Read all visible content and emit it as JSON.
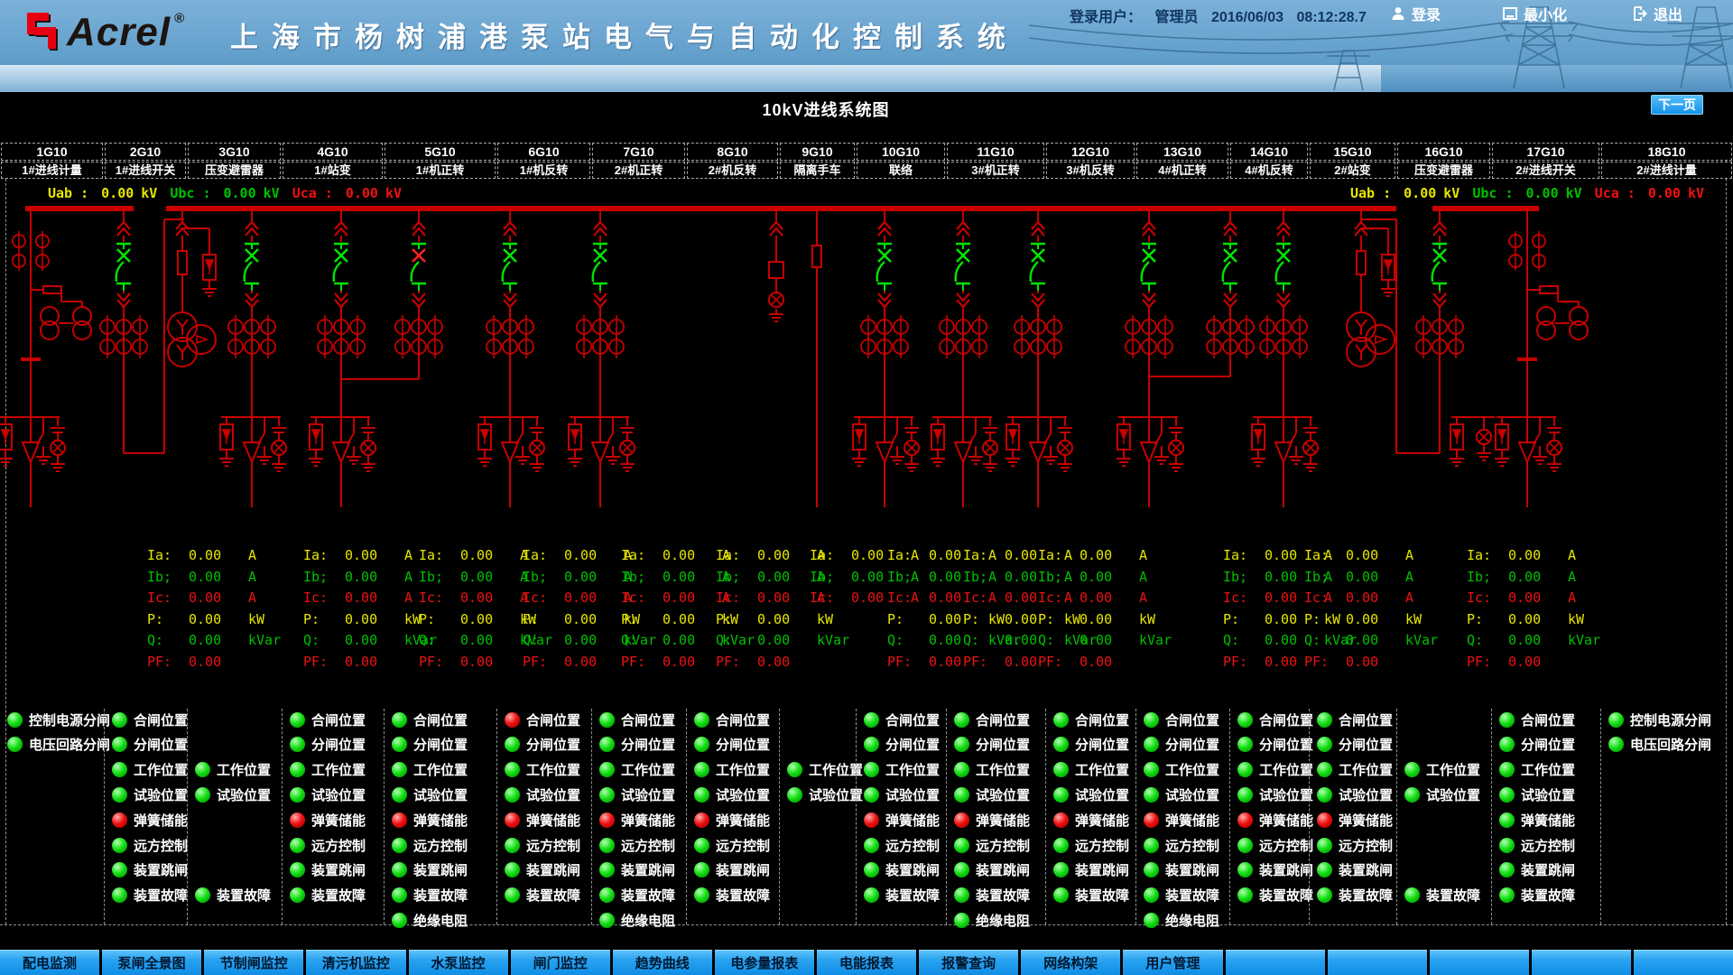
{
  "header": {
    "logo": "Acrel",
    "registered_mark": "®",
    "title": "上海市杨树浦港泵站电气与自动化控制系统"
  },
  "login_bar": {
    "user_label": "登录用户：",
    "user_name": "管理员",
    "date": "2016/06/03",
    "time": "08:12:28.7",
    "login_label": "登录",
    "minimize_label": "最小化",
    "exit_label": "退出"
  },
  "page": {
    "title": "10kV进线系统图",
    "next_page_label": "下一页"
  },
  "feeder_columns": [
    {
      "id": "1G10",
      "label": "1#进线计量"
    },
    {
      "id": "2G10",
      "label": "1#进线开关"
    },
    {
      "id": "3G10",
      "label": "压变避雷器"
    },
    {
      "id": "4G10",
      "label": "1#站变"
    },
    {
      "id": "5G10",
      "label": "1#机正转"
    },
    {
      "id": "6G10",
      "label": "1#机反转"
    },
    {
      "id": "7G10",
      "label": "2#机正转"
    },
    {
      "id": "8G10",
      "label": "2#机反转"
    },
    {
      "id": "9G10",
      "label": "隔离手车"
    },
    {
      "id": "10G10",
      "label": "联络"
    },
    {
      "id": "11G10",
      "label": "3#机正转"
    },
    {
      "id": "12G10",
      "label": "3#机反转"
    },
    {
      "id": "13G10",
      "label": "4#机正转"
    },
    {
      "id": "14G10",
      "label": "4#机反转"
    },
    {
      "id": "15G10",
      "label": "2#站变"
    },
    {
      "id": "16G10",
      "label": "压变避雷器"
    },
    {
      "id": "17G10",
      "label": "2#进线开关"
    },
    {
      "id": "18G10",
      "label": "2#进线计量"
    }
  ],
  "bus_voltages": {
    "left": [
      {
        "label": "Uab :",
        "value": "0.00",
        "unit": "kV",
        "color": "#e6e600"
      },
      {
        "label": "Ubc :",
        "value": "0.00",
        "unit": "kV",
        "color": "#00c000"
      },
      {
        "label": "Uca :",
        "value": "0.00",
        "unit": "kV",
        "color": "#ee1111"
      }
    ],
    "right": [
      {
        "label": "Uab :",
        "value": "0.00",
        "unit": "kV",
        "color": "#e6e600"
      },
      {
        "label": "Ubc :",
        "value": "0.00",
        "unit": "kV",
        "color": "#00c000"
      },
      {
        "label": "Uca :",
        "value": "0.00",
        "unit": "kV",
        "color": "#ee1111"
      }
    ]
  },
  "measurements": {
    "row_defs": [
      {
        "label": "Ia:",
        "value": "0.00",
        "unit": "A",
        "color": "#e6e600"
      },
      {
        "label": "Ib;",
        "value": "0.00",
        "unit": "A",
        "color": "#00c000"
      },
      {
        "label": "Ic:",
        "value": "0.00",
        "unit": "A",
        "color": "#ee1111"
      },
      {
        "label": "P:",
        "value": "0.00",
        "unit": "kW",
        "color": "#e6e600"
      },
      {
        "label": "Q:",
        "value": "0.00",
        "unit": "kVar",
        "color": "#00c000"
      },
      {
        "label": "PF:",
        "value": "0.00",
        "unit": "",
        "color": "#ee1111"
      }
    ],
    "groups": [
      {
        "type": "full"
      },
      {
        "type": "full"
      },
      {
        "type": "full"
      },
      {
        "type": "full"
      },
      {
        "type": "full"
      },
      {
        "type": "full"
      },
      {
        "type": "currents_only"
      },
      {
        "type": "full"
      },
      {
        "type": "full"
      },
      {
        "type": "full"
      },
      {
        "type": "full"
      },
      {
        "type": "full"
      },
      {
        "type": "full"
      }
    ]
  },
  "status_panel": {
    "columns": [
      {
        "leds": [
          {
            "row": 1,
            "label": "控制电源分闸",
            "color": "green"
          },
          {
            "row": 2,
            "label": "电压回路分闸",
            "color": "green"
          }
        ]
      },
      {
        "leds": [
          {
            "row": 1,
            "label": "合闸位置",
            "color": "green"
          },
          {
            "row": 2,
            "label": "分闸位置",
            "color": "green"
          },
          {
            "row": 3,
            "label": "工作位置",
            "color": "green"
          },
          {
            "row": 4,
            "label": "试验位置",
            "color": "green"
          },
          {
            "row": 5,
            "label": "弹簧储能",
            "color": "red"
          },
          {
            "row": 6,
            "label": "远方控制",
            "color": "green"
          },
          {
            "row": 7,
            "label": "装置跳闸",
            "color": "green"
          },
          {
            "row": 8,
            "label": "装置故障",
            "color": "green"
          }
        ]
      },
      {
        "leds": [
          {
            "row": 3,
            "label": "工作位置",
            "color": "green"
          },
          {
            "row": 4,
            "label": "试验位置",
            "color": "green"
          },
          {
            "row": 8,
            "label": "装置故障",
            "color": "green"
          }
        ]
      },
      {
        "leds": [
          {
            "row": 1,
            "label": "合闸位置",
            "color": "green"
          },
          {
            "row": 2,
            "label": "分闸位置",
            "color": "green"
          },
          {
            "row": 3,
            "label": "工作位置",
            "color": "green"
          },
          {
            "row": 4,
            "label": "试验位置",
            "color": "green"
          },
          {
            "row": 5,
            "label": "弹簧储能",
            "color": "red"
          },
          {
            "row": 6,
            "label": "远方控制",
            "color": "green"
          },
          {
            "row": 7,
            "label": "装置跳闸",
            "color": "green"
          },
          {
            "row": 8,
            "label": "装置故障",
            "color": "green"
          }
        ]
      },
      {
        "leds": [
          {
            "row": 1,
            "label": "合闸位置",
            "color": "green"
          },
          {
            "row": 2,
            "label": "分闸位置",
            "color": "green"
          },
          {
            "row": 3,
            "label": "工作位置",
            "color": "green"
          },
          {
            "row": 4,
            "label": "试验位置",
            "color": "green"
          },
          {
            "row": 5,
            "label": "弹簧储能",
            "color": "red"
          },
          {
            "row": 6,
            "label": "远方控制",
            "color": "green"
          },
          {
            "row": 7,
            "label": "装置跳闸",
            "color": "green"
          },
          {
            "row": 8,
            "label": "装置故障",
            "color": "green"
          },
          {
            "row": 9,
            "label": "绝缘电阻",
            "color": "green"
          }
        ]
      },
      {
        "leds": [
          {
            "row": 1,
            "label": "合闸位置",
            "color": "red"
          },
          {
            "row": 2,
            "label": "分闸位置",
            "color": "green"
          },
          {
            "row": 3,
            "label": "工作位置",
            "color": "green"
          },
          {
            "row": 4,
            "label": "试验位置",
            "color": "green"
          },
          {
            "row": 5,
            "label": "弹簧储能",
            "color": "red"
          },
          {
            "row": 6,
            "label": "远方控制",
            "color": "green"
          },
          {
            "row": 7,
            "label": "装置跳闸",
            "color": "green"
          },
          {
            "row": 8,
            "label": "装置故障",
            "color": "green"
          }
        ]
      },
      {
        "leds": [
          {
            "row": 1,
            "label": "合闸位置",
            "color": "green"
          },
          {
            "row": 2,
            "label": "分闸位置",
            "color": "green"
          },
          {
            "row": 3,
            "label": "工作位置",
            "color": "green"
          },
          {
            "row": 4,
            "label": "试验位置",
            "color": "green"
          },
          {
            "row": 5,
            "label": "弹簧储能",
            "color": "red"
          },
          {
            "row": 6,
            "label": "远方控制",
            "color": "green"
          },
          {
            "row": 7,
            "label": "装置跳闸",
            "color": "green"
          },
          {
            "row": 8,
            "label": "装置故障",
            "color": "green"
          },
          {
            "row": 9,
            "label": "绝缘电阻",
            "color": "green"
          }
        ]
      },
      {
        "leds": [
          {
            "row": 1,
            "label": "合闸位置",
            "color": "green"
          },
          {
            "row": 2,
            "label": "分闸位置",
            "color": "green"
          },
          {
            "row": 3,
            "label": "工作位置",
            "color": "green"
          },
          {
            "row": 4,
            "label": "试验位置",
            "color": "green"
          },
          {
            "row": 5,
            "label": "弹簧储能",
            "color": "red"
          },
          {
            "row": 6,
            "label": "远方控制",
            "color": "green"
          },
          {
            "row": 7,
            "label": "装置跳闸",
            "color": "green"
          },
          {
            "row": 8,
            "label": "装置故障",
            "color": "green"
          }
        ]
      },
      {
        "leds": [
          {
            "row": 3,
            "label": "工作位置",
            "color": "green"
          },
          {
            "row": 4,
            "label": "试验位置",
            "color": "green"
          }
        ]
      },
      {
        "leds": [
          {
            "row": 1,
            "label": "合闸位置",
            "color": "green"
          },
          {
            "row": 2,
            "label": "分闸位置",
            "color": "green"
          },
          {
            "row": 3,
            "label": "工作位置",
            "color": "green"
          },
          {
            "row": 4,
            "label": "试验位置",
            "color": "green"
          },
          {
            "row": 5,
            "label": "弹簧储能",
            "color": "red"
          },
          {
            "row": 6,
            "label": "远方控制",
            "color": "green"
          },
          {
            "row": 7,
            "label": "装置跳闸",
            "color": "green"
          },
          {
            "row": 8,
            "label": "装置故障",
            "color": "green"
          }
        ]
      },
      {
        "leds": [
          {
            "row": 1,
            "label": "合闸位置",
            "color": "green"
          },
          {
            "row": 2,
            "label": "分闸位置",
            "color": "green"
          },
          {
            "row": 3,
            "label": "工作位置",
            "color": "green"
          },
          {
            "row": 4,
            "label": "试验位置",
            "color": "green"
          },
          {
            "row": 5,
            "label": "弹簧储能",
            "color": "red"
          },
          {
            "row": 6,
            "label": "远方控制",
            "color": "green"
          },
          {
            "row": 7,
            "label": "装置跳闸",
            "color": "green"
          },
          {
            "row": 8,
            "label": "装置故障",
            "color": "green"
          },
          {
            "row": 9,
            "label": "绝缘电阻",
            "color": "green"
          }
        ]
      },
      {
        "leds": [
          {
            "row": 1,
            "label": "合闸位置",
            "color": "green"
          },
          {
            "row": 2,
            "label": "分闸位置",
            "color": "green"
          },
          {
            "row": 3,
            "label": "工作位置",
            "color": "green"
          },
          {
            "row": 4,
            "label": "试验位置",
            "color": "green"
          },
          {
            "row": 5,
            "label": "弹簧储能",
            "color": "red"
          },
          {
            "row": 6,
            "label": "远方控制",
            "color": "green"
          },
          {
            "row": 7,
            "label": "装置跳闸",
            "color": "green"
          },
          {
            "row": 8,
            "label": "装置故障",
            "color": "green"
          }
        ]
      },
      {
        "leds": [
          {
            "row": 1,
            "label": "合闸位置",
            "color": "green"
          },
          {
            "row": 2,
            "label": "分闸位置",
            "color": "green"
          },
          {
            "row": 3,
            "label": "工作位置",
            "color": "green"
          },
          {
            "row": 4,
            "label": "试验位置",
            "color": "green"
          },
          {
            "row": 5,
            "label": "弹簧储能",
            "color": "red"
          },
          {
            "row": 6,
            "label": "远方控制",
            "color": "green"
          },
          {
            "row": 7,
            "label": "装置跳闸",
            "color": "green"
          },
          {
            "row": 8,
            "label": "装置故障",
            "color": "green"
          },
          {
            "row": 9,
            "label": "绝缘电阻",
            "color": "green"
          }
        ]
      },
      {
        "leds": [
          {
            "row": 1,
            "label": "合闸位置",
            "color": "green"
          },
          {
            "row": 2,
            "label": "分闸位置",
            "color": "green"
          },
          {
            "row": 3,
            "label": "工作位置",
            "color": "green"
          },
          {
            "row": 4,
            "label": "试验位置",
            "color": "green"
          },
          {
            "row": 5,
            "label": "弹簧储能",
            "color": "red"
          },
          {
            "row": 6,
            "label": "远方控制",
            "color": "green"
          },
          {
            "row": 7,
            "label": "装置跳闸",
            "color": "green"
          },
          {
            "row": 8,
            "label": "装置故障",
            "color": "green"
          }
        ]
      },
      {
        "leds": [
          {
            "row": 1,
            "label": "合闸位置",
            "color": "green"
          },
          {
            "row": 2,
            "label": "分闸位置",
            "color": "green"
          },
          {
            "row": 3,
            "label": "工作位置",
            "color": "green"
          },
          {
            "row": 4,
            "label": "试验位置",
            "color": "green"
          },
          {
            "row": 5,
            "label": "弹簧储能",
            "color": "red"
          },
          {
            "row": 6,
            "label": "远方控制",
            "color": "green"
          },
          {
            "row": 7,
            "label": "装置跳闸",
            "color": "green"
          },
          {
            "row": 8,
            "label": "装置故障",
            "color": "green"
          }
        ]
      },
      {
        "leds": [
          {
            "row": 3,
            "label": "工作位置",
            "color": "green"
          },
          {
            "row": 4,
            "label": "试验位置",
            "color": "green"
          },
          {
            "row": 8,
            "label": "装置故障",
            "color": "green"
          }
        ]
      },
      {
        "leds": [
          {
            "row": 1,
            "label": "合闸位置",
            "color": "green"
          },
          {
            "row": 2,
            "label": "分闸位置",
            "color": "green"
          },
          {
            "row": 3,
            "label": "工作位置",
            "color": "green"
          },
          {
            "row": 4,
            "label": "试验位置",
            "color": "green"
          },
          {
            "row": 5,
            "label": "弹簧储能",
            "color": "green"
          },
          {
            "row": 6,
            "label": "远方控制",
            "color": "green"
          },
          {
            "row": 7,
            "label": "装置跳闸",
            "color": "green"
          },
          {
            "row": 8,
            "label": "装置故障",
            "color": "green"
          }
        ]
      },
      {
        "leds": [
          {
            "row": 1,
            "label": "控制电源分闸",
            "color": "green"
          },
          {
            "row": 2,
            "label": "电压回路分闸",
            "color": "green"
          }
        ]
      }
    ]
  },
  "nav": {
    "tabs": [
      "配电监测",
      "泵闸全景图",
      "节制闸监控",
      "清污机监控",
      "水泵监控",
      "闸门监控",
      "趋势曲线",
      "电参量报表",
      "电能报表",
      "报警查询",
      "网络构架",
      "用户管理"
    ],
    "empty_slots": 5
  },
  "colors": {
    "header_blue": "#6aa5d0",
    "nav_blue": "#28a2f0",
    "diagram_red": "#c80000",
    "breaker_green": "#00e400",
    "led_green": "#19e019",
    "led_red": "#f01414",
    "value_yellow": "#e6e600",
    "value_green": "#00c000",
    "value_red": "#ee1111"
  }
}
